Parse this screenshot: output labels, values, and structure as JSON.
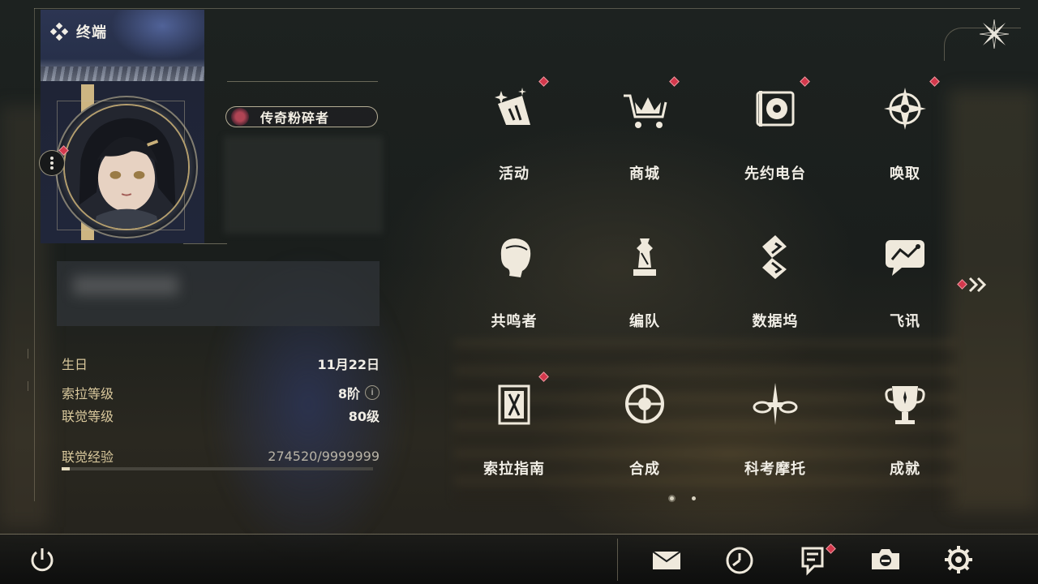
{
  "app": {
    "title": "终端"
  },
  "profile": {
    "title_badge": "传奇粉碎者",
    "stats": {
      "birthday": {
        "label": "生日",
        "value": "11月22日"
      },
      "sola_level": {
        "label": "索拉等级",
        "value": "8阶"
      },
      "union_level": {
        "label": "联觉等级",
        "value": "80级"
      },
      "union_exp": {
        "label": "联觉经验",
        "value": "274520/9999999",
        "progress": 0.027
      }
    }
  },
  "menu": {
    "items": [
      {
        "label": "活动",
        "icon": "events-icon",
        "badge": true
      },
      {
        "label": "商城",
        "icon": "shop-crown-cart-icon",
        "badge": true
      },
      {
        "label": "先约电台",
        "icon": "pioneer-radio-icon",
        "badge": true
      },
      {
        "label": "唤取",
        "icon": "convene-compass-icon",
        "badge": true
      },
      {
        "label": "共鸣者",
        "icon": "resonator-head-icon",
        "badge": false
      },
      {
        "label": "编队",
        "icon": "team-chess-icon",
        "badge": false
      },
      {
        "label": "数据坞",
        "icon": "data-bank-icon",
        "badge": false
      },
      {
        "label": "飞讯",
        "icon": "messages-chat-icon",
        "badge": false
      },
      {
        "label": "索拉指南",
        "icon": "guidebook-icon",
        "badge": true
      },
      {
        "label": "合成",
        "icon": "synthesis-icon",
        "badge": false
      },
      {
        "label": "科考摩托",
        "icon": "motorcycle-icon",
        "badge": false
      },
      {
        "label": "成就",
        "icon": "trophy-icon",
        "badge": false
      }
    ],
    "pages": {
      "current": 1,
      "total": 2
    }
  },
  "bottom_bar": {
    "icons": [
      "power-icon",
      "mail-icon",
      "clock-icon",
      "notice-icon",
      "camera-icon",
      "settings-gear-icon"
    ]
  },
  "colors": {
    "accent_gold": "#c9b07a",
    "badge_red": "#d3384c",
    "text_primary": "#f1eee6",
    "label_gold": "#d9c89c"
  }
}
